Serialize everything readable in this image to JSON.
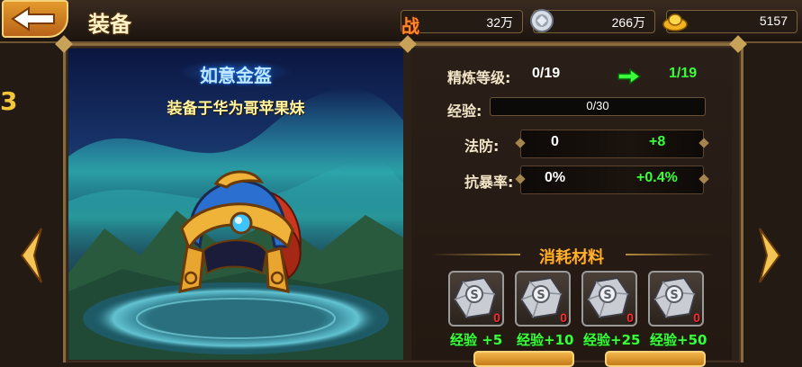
{
  "header": {
    "title": "装备",
    "back_icon": "back-arrow-icon"
  },
  "resources": {
    "power": {
      "label": "战",
      "value": "32万"
    },
    "silver": {
      "icon": "silver-coin-icon",
      "value": "266万"
    },
    "gold": {
      "icon": "gold-ingot-icon",
      "value": "5157"
    }
  },
  "item": {
    "name": "如意金盔",
    "equipped_on": "装备于华为哥苹果妹",
    "icon": "golden-helmet-icon"
  },
  "refine": {
    "label": "精炼等级:",
    "current": "0/19",
    "next": "1/19",
    "arrow_icon": "green-right-arrow-icon"
  },
  "experience": {
    "label": "经验:",
    "value": "0/30",
    "progress": 0
  },
  "stats": [
    {
      "label": "法防:",
      "value": "0",
      "bonus": "+8"
    },
    {
      "label": "抗暴率:",
      "value": "0%",
      "bonus": "+0.4%"
    }
  ],
  "materials": {
    "title": "消耗材料",
    "items": [
      {
        "icon": "silver-stone-icon",
        "count": "0",
        "label": "经验 +5"
      },
      {
        "icon": "silver-stone-icon",
        "count": "0",
        "label": "经验+10"
      },
      {
        "icon": "silver-stone-icon",
        "count": "0",
        "label": "经验+25"
      },
      {
        "icon": "silver-stone-icon",
        "count": "0",
        "label": "经验+50"
      }
    ]
  },
  "partial_left_label": "3",
  "colors": {
    "accent_gold": "#ffb12e",
    "bonus_green": "#3aff3a",
    "count_red": "#ff2a2a",
    "frame": "#8a6b3c"
  }
}
